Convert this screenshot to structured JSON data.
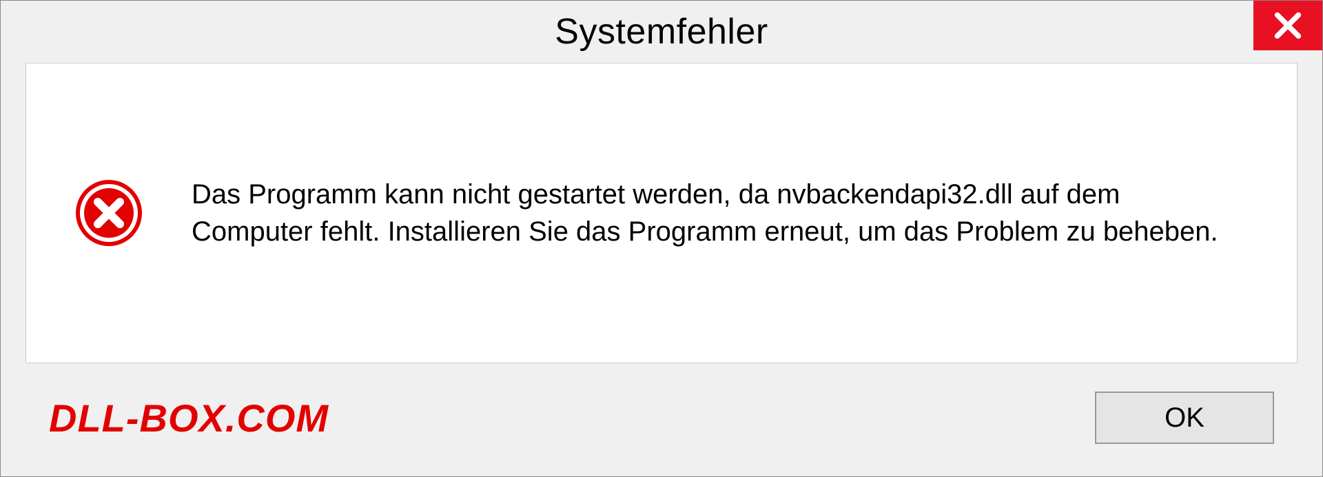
{
  "dialog": {
    "title": "Systemfehler",
    "message": "Das Programm kann nicht gestartet werden, da nvbackendapi32.dll auf dem Computer fehlt. Installieren Sie das Programm erneut, um das Problem zu beheben.",
    "ok_label": "OK"
  },
  "watermark": "DLL-BOX.COM"
}
